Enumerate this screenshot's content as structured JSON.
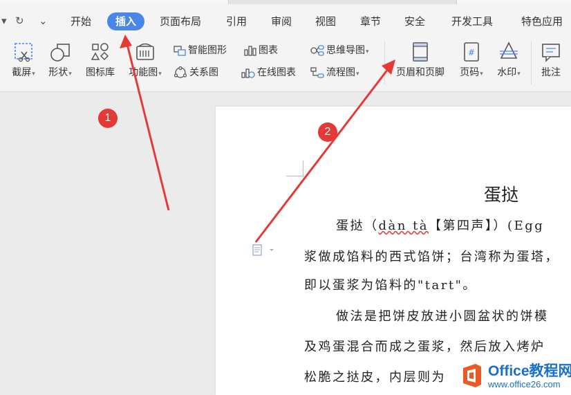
{
  "quick_access": {
    "undo_dd": "▾",
    "redo": "↻",
    "more": "⌄"
  },
  "menu": {
    "items": [
      "开始",
      "插入",
      "页面布局",
      "引用",
      "审阅",
      "视图",
      "章节",
      "安全",
      "开发工具",
      "特色应用"
    ],
    "active": "插入"
  },
  "ribbon": {
    "screenshot": "截屏",
    "shape": "形状",
    "icon_lib": "图标库",
    "func_chart": "功能图",
    "smart_art": "智能图形",
    "chart": "图表",
    "mindmap": "思维导图",
    "relation": "关系图",
    "online_chart": "在线图表",
    "flowchart": "流程图",
    "header_footer": "页眉和页脚",
    "page_number": "页码",
    "watermark": "水印",
    "comment": "批注"
  },
  "document": {
    "title": "蛋挞",
    "line1_a": "蛋挞（",
    "line1_pinyin": "dàn tà",
    "line1_b": "【第四声】）(Egg",
    "line2": "浆做成馅料的西式馅饼；台湾称为蛋塔，",
    "line3": "即以蛋浆为馅料的\"tart\"。",
    "line4": "做法是把饼皮放进小圆盆状的饼模",
    "line5": "及鸡蛋混合而成之蛋浆，然后放入烤炉",
    "line6": "松脆之挞皮，内层则为"
  },
  "annotations": {
    "badge1": "1",
    "badge2": "2",
    "arrow_color": "#e53935"
  },
  "watermark_site": {
    "line1": "Office教程网",
    "line2": "www.office26.com"
  },
  "colors": {
    "active_tab": "#4a86e8",
    "badge": "#e53935",
    "brand": "#1a6fc9"
  }
}
